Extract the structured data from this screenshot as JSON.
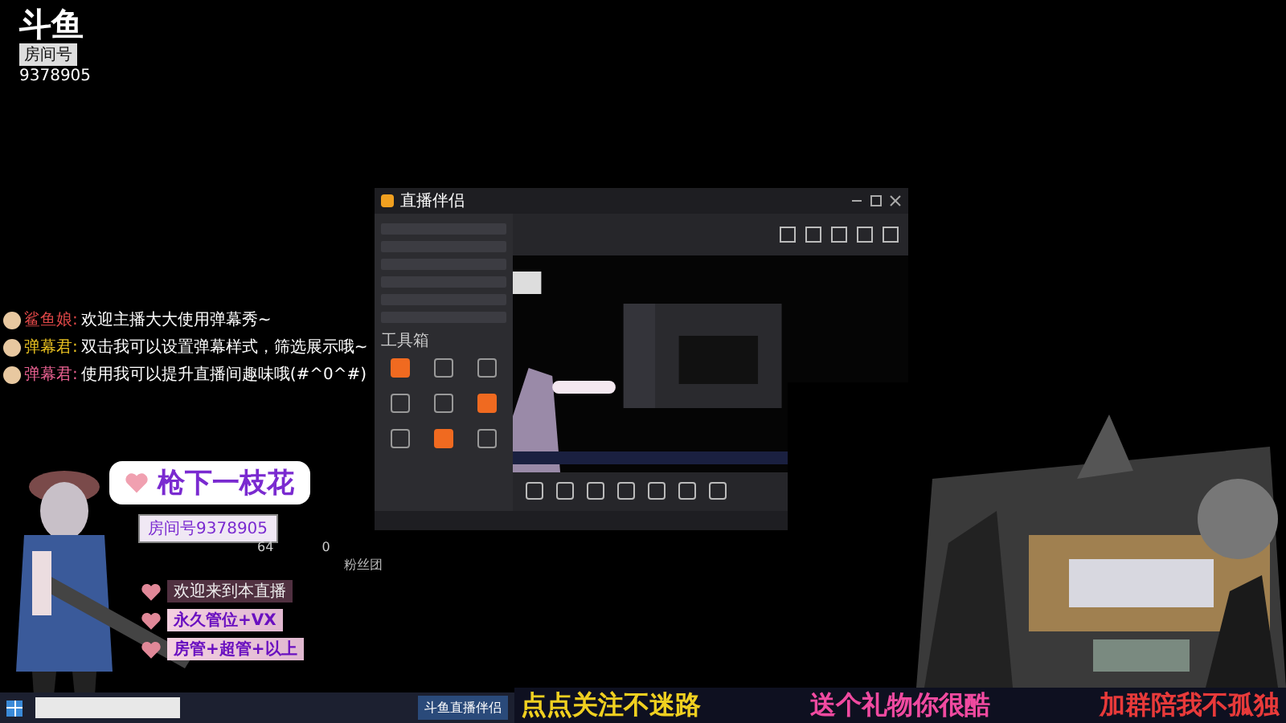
{
  "logo": {
    "brand": "斗鱼",
    "room_label": "房间号",
    "room_id": "9378905"
  },
  "chat": [
    {
      "user": "鲨鱼娘:",
      "text": "欢迎主播大大使用弹幕秀~",
      "color": "#e04848"
    },
    {
      "user": "弹幕君:",
      "text": "双击我可以设置弹幕样式，筛选展示哦~",
      "color": "#e8c020"
    },
    {
      "user": "弹幕君:",
      "text": "使用我可以提升直播间趣味哦(#^0^#)",
      "color": "#e86090"
    }
  ],
  "window": {
    "title": "直播伴侣",
    "sidebar_section": "工具箱",
    "tools": [
      {
        "highlighted": true
      },
      {
        "highlighted": false
      },
      {
        "highlighted": false
      },
      {
        "highlighted": false
      },
      {
        "highlighted": false
      },
      {
        "highlighted": true
      },
      {
        "highlighted": false
      },
      {
        "highlighted": true
      },
      {
        "highlighted": false
      }
    ]
  },
  "name_card": {
    "name": "枪下一枝花",
    "room": "房间号9378905"
  },
  "stats": [
    "64",
    "0"
  ],
  "overlay": {
    "fan_club": "粉丝团",
    "lines": [
      {
        "text": "欢迎来到本直播",
        "kind": "plain"
      },
      {
        "text": "永久管位+VX",
        "kind": "tag"
      },
      {
        "text": "房管+超管+以上",
        "kind": "tag"
      }
    ]
  },
  "taskbar": {
    "app": "斗鱼直播伴侣"
  },
  "banner": [
    {
      "text": "点点关注不迷路",
      "color": "#f0d020"
    },
    {
      "text": "送个礼物你很酷",
      "color": "#f04aa0"
    },
    {
      "text": "加群陪我不孤独",
      "color": "#e83a3a"
    }
  ]
}
